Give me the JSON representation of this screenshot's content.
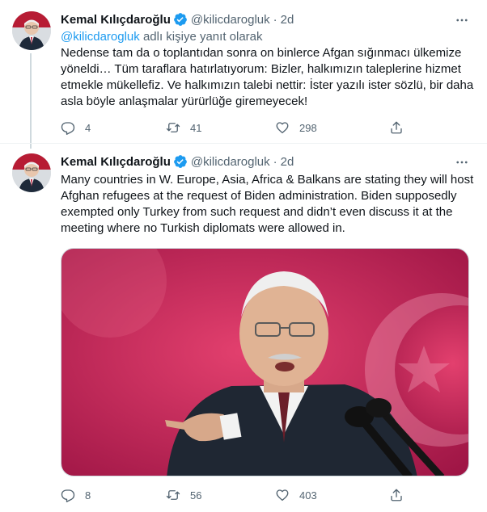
{
  "tweets": [
    {
      "name": "Kemal Kılıçdaroğlu",
      "handle": "@kilicdarogluk",
      "dot": "·",
      "time": "2d",
      "reply_mention": "@kilicdarogluk",
      "reply_suffix": "adlı kişiye yanıt olarak",
      "text_lines": [
        "Nedense tam da o toplantıdan sonra on binlerce Afgan sığınmacı ülkemize",
        "yöneldi… Tüm taraflara hatırlatıyorum: Bizler, halkımızın taleplerine hizmet",
        "etmekle mükellefiz. Ve halkımızın talebi nettir: İster yazılı ister sözlü, bir daha",
        "asla böyle anlaşmalar yürürlüğe giremeyecek!"
      ],
      "replies": "4",
      "retweets": "41",
      "likes": "298"
    },
    {
      "name": "Kemal Kılıçdaroğlu",
      "handle": "@kilicdarogluk",
      "dot": "·",
      "time": "2d",
      "text_lines": [
        "Many countries in W. Europe, Asia, Africa & Balkans are stating they will host",
        "Afghan refugees at the request of Biden administration. Biden supposedly",
        "exempted only Turkey from such request and didn’t even discuss it at the",
        "meeting where no Turkish diplomats were allowed in."
      ],
      "replies": "8",
      "retweets": "56",
      "likes": "403"
    }
  ],
  "icons": {
    "verified": "verified-badge-icon",
    "more": "more-options-icon",
    "reply": "reply-icon",
    "retweet": "retweet-icon",
    "like": "like-icon",
    "share": "share-icon"
  },
  "colors": {
    "accent": "#1d9bf0",
    "secondary_text": "#536471",
    "media_background": "#c2185b"
  }
}
